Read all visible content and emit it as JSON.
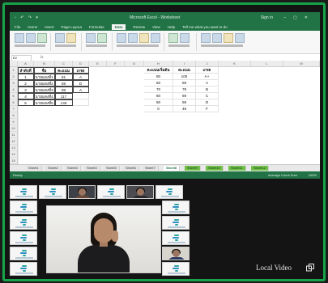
{
  "excel": {
    "title": "Microsoft Excel - Worksheet",
    "user": "Sign in",
    "menu_tabs": [
      "File",
      "Home",
      "Insert",
      "Page Layout",
      "Formulas",
      "Data",
      "Review",
      "View",
      "Help",
      "Tell me what you want to do"
    ],
    "active_tab_index": 5,
    "formula_bar": {
      "name_box": "E2",
      "fx": "fx",
      "value": ""
    },
    "column_letters": [
      "A",
      "B",
      "C",
      "D",
      "E",
      "F",
      "G",
      "H",
      "I",
      "J",
      "K",
      "L",
      "M",
      "N"
    ],
    "row_numbers": [
      "1",
      "2",
      "3",
      "4",
      "5",
      "6",
      "7",
      "8",
      "9",
      "10",
      "11",
      "12",
      "13",
      "14",
      "15"
    ],
    "table1": {
      "headers": [
        "ลำดับที่",
        "ชื่อ",
        "คะแนน",
        "เกรด"
      ],
      "rows": [
        [
          "1",
          "นายแดงที่1",
          "81",
          "A"
        ],
        [
          "2",
          "นายแดงที่2",
          "59",
          "D"
        ],
        [
          "3",
          "นายแดงที่3",
          "88",
          "A"
        ],
        [
          "4",
          "นายแดงที่4",
          "117",
          ""
        ],
        [
          "5",
          "นายแดงที่5",
          "148",
          ""
        ]
      ]
    },
    "table2": {
      "headers": [
        "คะแนนเริ่มต้น",
        "คะแนน",
        "เกรด"
      ],
      "rows": [
        [
          "80",
          "100",
          "A+"
        ],
        [
          "60",
          "69",
          "A"
        ],
        [
          "70",
          "79",
          "B"
        ],
        [
          "60",
          "69",
          "C"
        ],
        [
          "50",
          "59",
          "D"
        ],
        [
          "0",
          "49",
          "F"
        ]
      ]
    },
    "sheet_tabs": [
      "Sheet1",
      "Sheet2",
      "Sheet3",
      "Sheet4",
      "Sheet5",
      "Sheet6",
      "Sheet7",
      "Sheet8",
      "Sheet9",
      "Sheet10",
      "Sheet11",
      "Sheet12"
    ],
    "status": {
      "left": "Ready",
      "right": "Average  Count  Sum",
      "zoom": "100%"
    }
  },
  "video": {
    "local_label": "Local Video"
  },
  "colors": {
    "frame_border": "#17a34a",
    "excel_green": "#217346",
    "background": "#141414"
  },
  "icons": {
    "local_video": "pop-out-window-icon"
  }
}
